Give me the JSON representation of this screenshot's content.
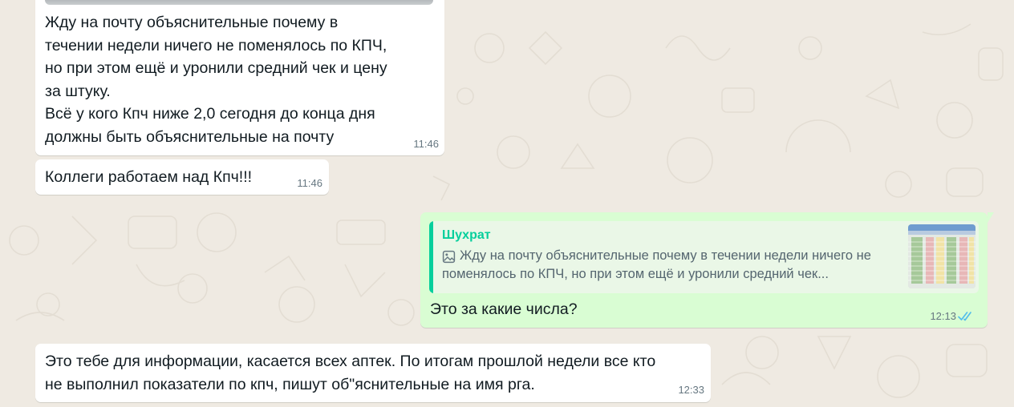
{
  "messages": [
    {
      "direction": "incoming",
      "text": "Жду на почту объяснительные почему в\nтечении недели ничего не поменялось по КПЧ,\nно при этом ещё и уронили средний чек и цену\nза штуку.\nВсё у кого Кпч ниже 2,0 сегодня до конца дня\nдолжны быть объяснительные на почту",
      "time": "11:46"
    },
    {
      "direction": "incoming",
      "text": "Коллеги работаем над Кпч!!!",
      "time": "11:46"
    },
    {
      "direction": "outgoing",
      "quote": {
        "author": "Шухрат",
        "icon": "image-icon",
        "text": "Жду на почту объяснительные почему в течении недели ничего не поменялось по КПЧ, но при этом ещё и уронили средний чек..."
      },
      "text": "Это за какие числа?",
      "time": "12:13",
      "status": "read",
      "status_color": "#53bdeb"
    },
    {
      "direction": "incoming",
      "text": "Это тебе для информации, касается всех аптек. По итогам прошлой недели все кто\nне выполнил показатели по кпч, пишут об\"яснительные на имя рга.",
      "time": "12:33"
    }
  ],
  "colors": {
    "background": "#efeae2",
    "incoming_bubble": "#ffffff",
    "outgoing_bubble": "#d9fdd3",
    "quote_accent": "#06cf9c"
  }
}
